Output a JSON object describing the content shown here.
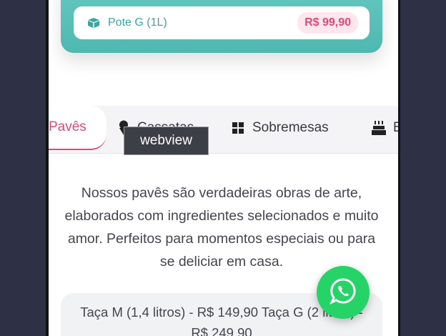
{
  "product_card": {
    "size_label": "Pote G (1L)",
    "price": "R$ 99,90"
  },
  "tabs": [
    {
      "label": "Pavês",
      "icon": "cake-slice-icon",
      "active": true
    },
    {
      "label": "Cassatas",
      "icon": "ice-cream-icon",
      "active": false
    },
    {
      "label": "Sobremesas",
      "icon": "cookie-icon",
      "active": false
    },
    {
      "label": "B",
      "icon": "birthday-cake-icon",
      "active": false
    }
  ],
  "tooltip": "webview",
  "description": "Nossos pavês são verdadeiras obras de arte, elaborados com ingredientes selecionados e muito amor. Perfeitos para momentos especiais ou para se deliciar em casa.",
  "price_list": "Taça M (1,4 litros) - R$ 149,90    Taça G (2 litros) - R$ 249,90",
  "whatsapp": {
    "icon": "whatsapp-icon"
  },
  "colors": {
    "accent": "#e0497a",
    "teal": "#4fb8b0",
    "whatsapp": "#25d366",
    "background": "#2e3146"
  }
}
